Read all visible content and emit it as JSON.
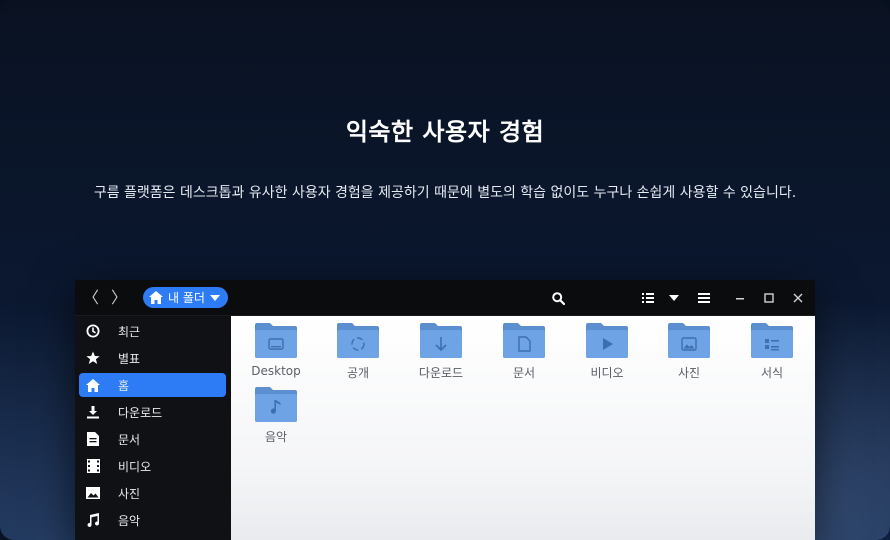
{
  "hero": {
    "title": "익숙한 사용자 경험",
    "subtitle": "구름 플랫폼은 데스크톱과 유사한 사용자 경험을 제공하기 때문에 별도의 학습 없이도 누구나 손쉽게 사용할 수 있습니다."
  },
  "window": {
    "nav": {
      "back": "〈",
      "forward": "〉"
    },
    "location": {
      "label": "내 폴더",
      "icon": "home-icon"
    },
    "toolbar": [
      "search-icon",
      "list-view-icon",
      "dropdown-arrow-icon",
      "menu-icon",
      "minimize-icon",
      "maximize-icon",
      "close-icon"
    ],
    "accent": "#2d7cf6",
    "sidebar": {
      "items": [
        {
          "label": "최근",
          "icon": "clock-icon"
        },
        {
          "label": "별표",
          "icon": "star-icon"
        },
        {
          "label": "홈",
          "icon": "home-icon",
          "active": true
        },
        {
          "label": "다운로드",
          "icon": "download-icon"
        },
        {
          "label": "문서",
          "icon": "document-icon"
        },
        {
          "label": "비디오",
          "icon": "film-icon"
        },
        {
          "label": "사진",
          "icon": "image-icon"
        },
        {
          "label": "음악",
          "icon": "music-icon"
        }
      ]
    },
    "folders": [
      {
        "label": "Desktop",
        "icon": "desktop-folder-icon"
      },
      {
        "label": "공개",
        "icon": "share-folder-icon"
      },
      {
        "label": "다운로드",
        "icon": "download-folder-icon"
      },
      {
        "label": "문서",
        "icon": "document-folder-icon"
      },
      {
        "label": "비디오",
        "icon": "video-folder-icon"
      },
      {
        "label": "사진",
        "icon": "pictures-folder-icon"
      },
      {
        "label": "서식",
        "icon": "templates-folder-icon"
      },
      {
        "label": "음악",
        "icon": "music-folder-icon"
      }
    ]
  }
}
